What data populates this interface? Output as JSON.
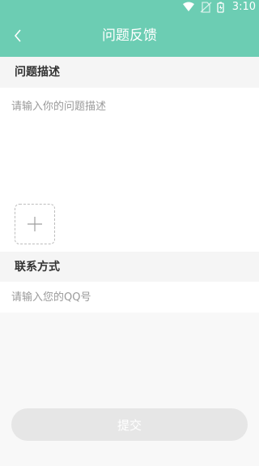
{
  "status_bar": {
    "time": "3:10",
    "icons": [
      "wifi-icon",
      "no-sim-icon",
      "battery-charging-icon"
    ]
  },
  "header": {
    "title": "问题反馈",
    "back_icon": "chevron-left-icon",
    "background": "#6ccdb3"
  },
  "description": {
    "label": "问题描述",
    "placeholder": "请输入你的问题描述",
    "value": "",
    "add_image_icon": "plus-icon"
  },
  "contact": {
    "label": "联系方式",
    "placeholder": "请输入您的QQ号",
    "value": ""
  },
  "submit": {
    "label": "提交",
    "background": "#e6e6e6"
  }
}
